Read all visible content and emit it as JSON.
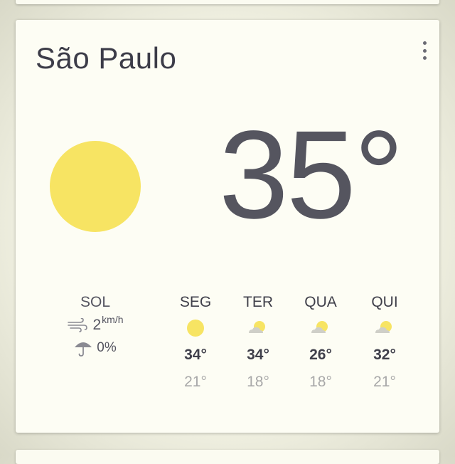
{
  "city": "São Paulo",
  "current": {
    "temperature": "35°",
    "condition": "SOL",
    "condition_icon": "sun-icon",
    "wind": {
      "value": "2",
      "unit": "km/h",
      "icon": "wind-icon"
    },
    "rain": {
      "value": "0%",
      "icon": "umbrella-icon"
    }
  },
  "forecast": [
    {
      "day": "SEG",
      "icon": "sun-icon",
      "high": "34°",
      "low": "21°"
    },
    {
      "day": "TER",
      "icon": "partly-cloudy-icon",
      "high": "34°",
      "low": "18°"
    },
    {
      "day": "QUA",
      "icon": "partly-cloudy-icon",
      "high": "26°",
      "low": "18°"
    },
    {
      "day": "QUI",
      "icon": "partly-cloudy-icon",
      "high": "32°",
      "low": "21°"
    }
  ],
  "colors": {
    "sun": "#f7e463",
    "text_primary": "#3f3f4a",
    "text_secondary": "#a8a8a8",
    "card_background": "#fdfdf4"
  }
}
